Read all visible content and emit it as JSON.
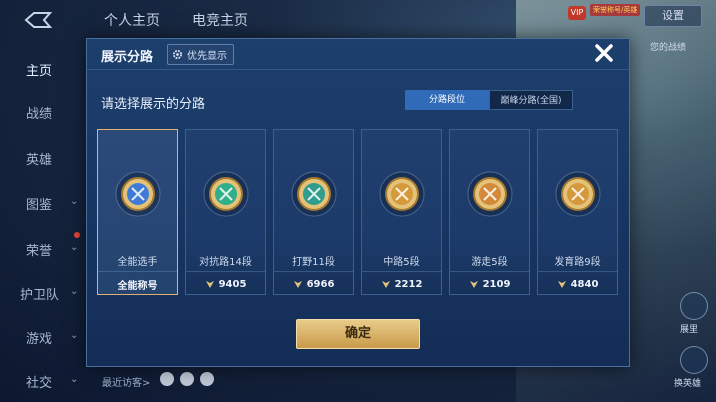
{
  "topbar": {
    "tabs": [
      "个人主页",
      "电竞主页"
    ],
    "vip": "VIP",
    "note": "荣誉称号/英雄",
    "settings_label": "设置",
    "side_note": "您的战绩"
  },
  "sidebar": {
    "items": [
      {
        "label": "主页",
        "chevron": false
      },
      {
        "label": "战绩",
        "chevron": false
      },
      {
        "label": "英雄",
        "chevron": false
      },
      {
        "label": "图鉴",
        "chevron": true
      },
      {
        "label": "荣誉",
        "chevron": true
      },
      {
        "label": "护卫队",
        "chevron": true
      },
      {
        "label": "游戏",
        "chevron": true
      },
      {
        "label": "社交",
        "chevron": true
      }
    ]
  },
  "bottom": {
    "recent_visitors": "最近访客>",
    "right_labels": [
      "展里",
      "换英雄"
    ]
  },
  "dialog": {
    "title": "展示分路",
    "priority_label": "优先显示",
    "prompt": "请选择展示的分路",
    "segment_on": "分路段位",
    "segment_off": "巅峰分路(全国)",
    "confirm_label": "确定",
    "cards": [
      {
        "label": "全能选手",
        "footer": "全能称号",
        "has_score": false,
        "selected": true,
        "emblem": "all-round-emblem-icon",
        "color": "#3f7bd6"
      },
      {
        "label": "对抗路14段",
        "footer": "9405",
        "has_score": true,
        "selected": false,
        "emblem": "clash-lane-emblem-icon",
        "color": "#2fb08a"
      },
      {
        "label": "打野11段",
        "footer": "6966",
        "has_score": true,
        "selected": false,
        "emblem": "jungle-emblem-icon",
        "color": "#2f9c8c"
      },
      {
        "label": "中路5段",
        "footer": "2212",
        "has_score": true,
        "selected": false,
        "emblem": "mid-lane-emblem-icon",
        "color": "#d49a3a"
      },
      {
        "label": "游走5段",
        "footer": "2109",
        "has_score": true,
        "selected": false,
        "emblem": "roam-emblem-icon",
        "color": "#d4883a"
      },
      {
        "label": "发育路9段",
        "footer": "4840",
        "has_score": true,
        "selected": false,
        "emblem": "farm-lane-emblem-icon",
        "color": "#d4993a"
      }
    ]
  },
  "colors": {
    "accent": "#2f6bb8",
    "gold": "#c99a4a",
    "panel": "#173461"
  }
}
